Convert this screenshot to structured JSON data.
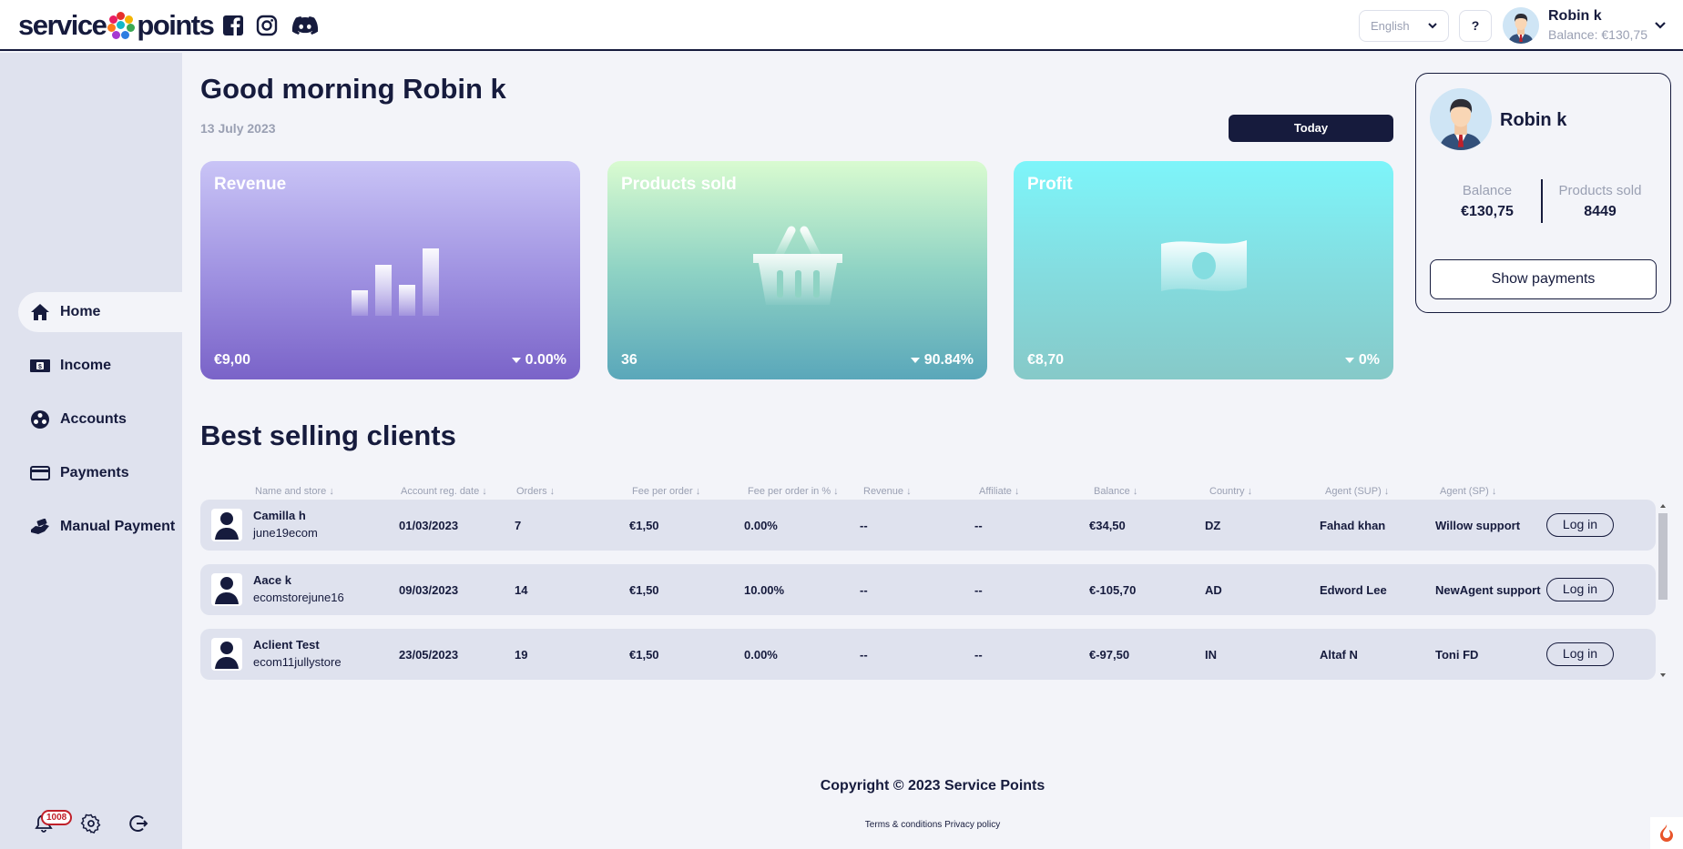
{
  "brand": {
    "left": "service",
    "right": "points",
    "dot_colors": [
      "#e5302a",
      "#f4b400",
      "#3aa853",
      "#2e7de1",
      "#a63ad1",
      "#ff7a1a",
      "#12b7c7",
      "#e91e63"
    ]
  },
  "header": {
    "language": "English",
    "help": "?",
    "user_name": "Robin k",
    "balance": "Balance: €130,75"
  },
  "sidebar": {
    "items": [
      {
        "label": "Home",
        "icon": "home-icon",
        "active": true
      },
      {
        "label": "Income",
        "icon": "cash-icon"
      },
      {
        "label": "Accounts",
        "icon": "accounts-icon"
      },
      {
        "label": "Payments",
        "icon": "card-icon"
      },
      {
        "label": "Manual Payment",
        "icon": "hand-money-icon"
      }
    ],
    "notification_count": "1008"
  },
  "main": {
    "greeting": "Good morning Robin k",
    "date": "13 July 2023",
    "period_button": "Today",
    "cards": [
      {
        "title": "Revenue",
        "value": "€9,00",
        "change": "0.00%"
      },
      {
        "title": "Products sold",
        "value": "36",
        "change": "90.84%"
      },
      {
        "title": "Profit",
        "value": "€8,70",
        "change": "0%"
      }
    ]
  },
  "profile": {
    "name": "Robin k",
    "balance_label": "Balance",
    "balance_value": "€130,75",
    "sold_label": "Products sold",
    "sold_value": "8449",
    "button": "Show payments"
  },
  "clients": {
    "title": "Best selling clients",
    "columns": [
      "Name and store",
      "Account reg. date",
      "Orders",
      "Fee per order",
      "Fee per order in %",
      "Revenue",
      "Affiliate",
      "Balance",
      "Country",
      "Agent (SUP)",
      "Agent (SP)"
    ],
    "login_label": "Log in",
    "rows": [
      {
        "name": "Camilla h",
        "store": "june19ecom",
        "date": "01/03/2023",
        "orders": "7",
        "fee": "€1,50",
        "fee_pct": "0.00%",
        "revenue": "--",
        "affiliate": "--",
        "balance": "€34,50",
        "country": "DZ",
        "agent_sup": "Fahad khan",
        "agent_sp": "Willow support"
      },
      {
        "name": "Aace k",
        "store": "ecomstorejune16",
        "date": "09/03/2023",
        "orders": "14",
        "fee": "€1,50",
        "fee_pct": "10.00%",
        "revenue": "--",
        "affiliate": "--",
        "balance": "€-105,70",
        "country": "AD",
        "agent_sup": "Edword Lee",
        "agent_sp": "NewAgent support"
      },
      {
        "name": "Aclient Test",
        "store": "ecom11jullystore",
        "date": "23/05/2023",
        "orders": "19",
        "fee": "€1,50",
        "fee_pct": "0.00%",
        "revenue": "--",
        "affiliate": "--",
        "balance": "€-97,50",
        "country": "IN",
        "agent_sup": "Altaf N",
        "agent_sp": "Toni FD"
      }
    ]
  },
  "footer": {
    "copyright": "Copyright © 2023 Service Points",
    "terms": "Terms & conditions",
    "privacy": "Privacy policy"
  }
}
